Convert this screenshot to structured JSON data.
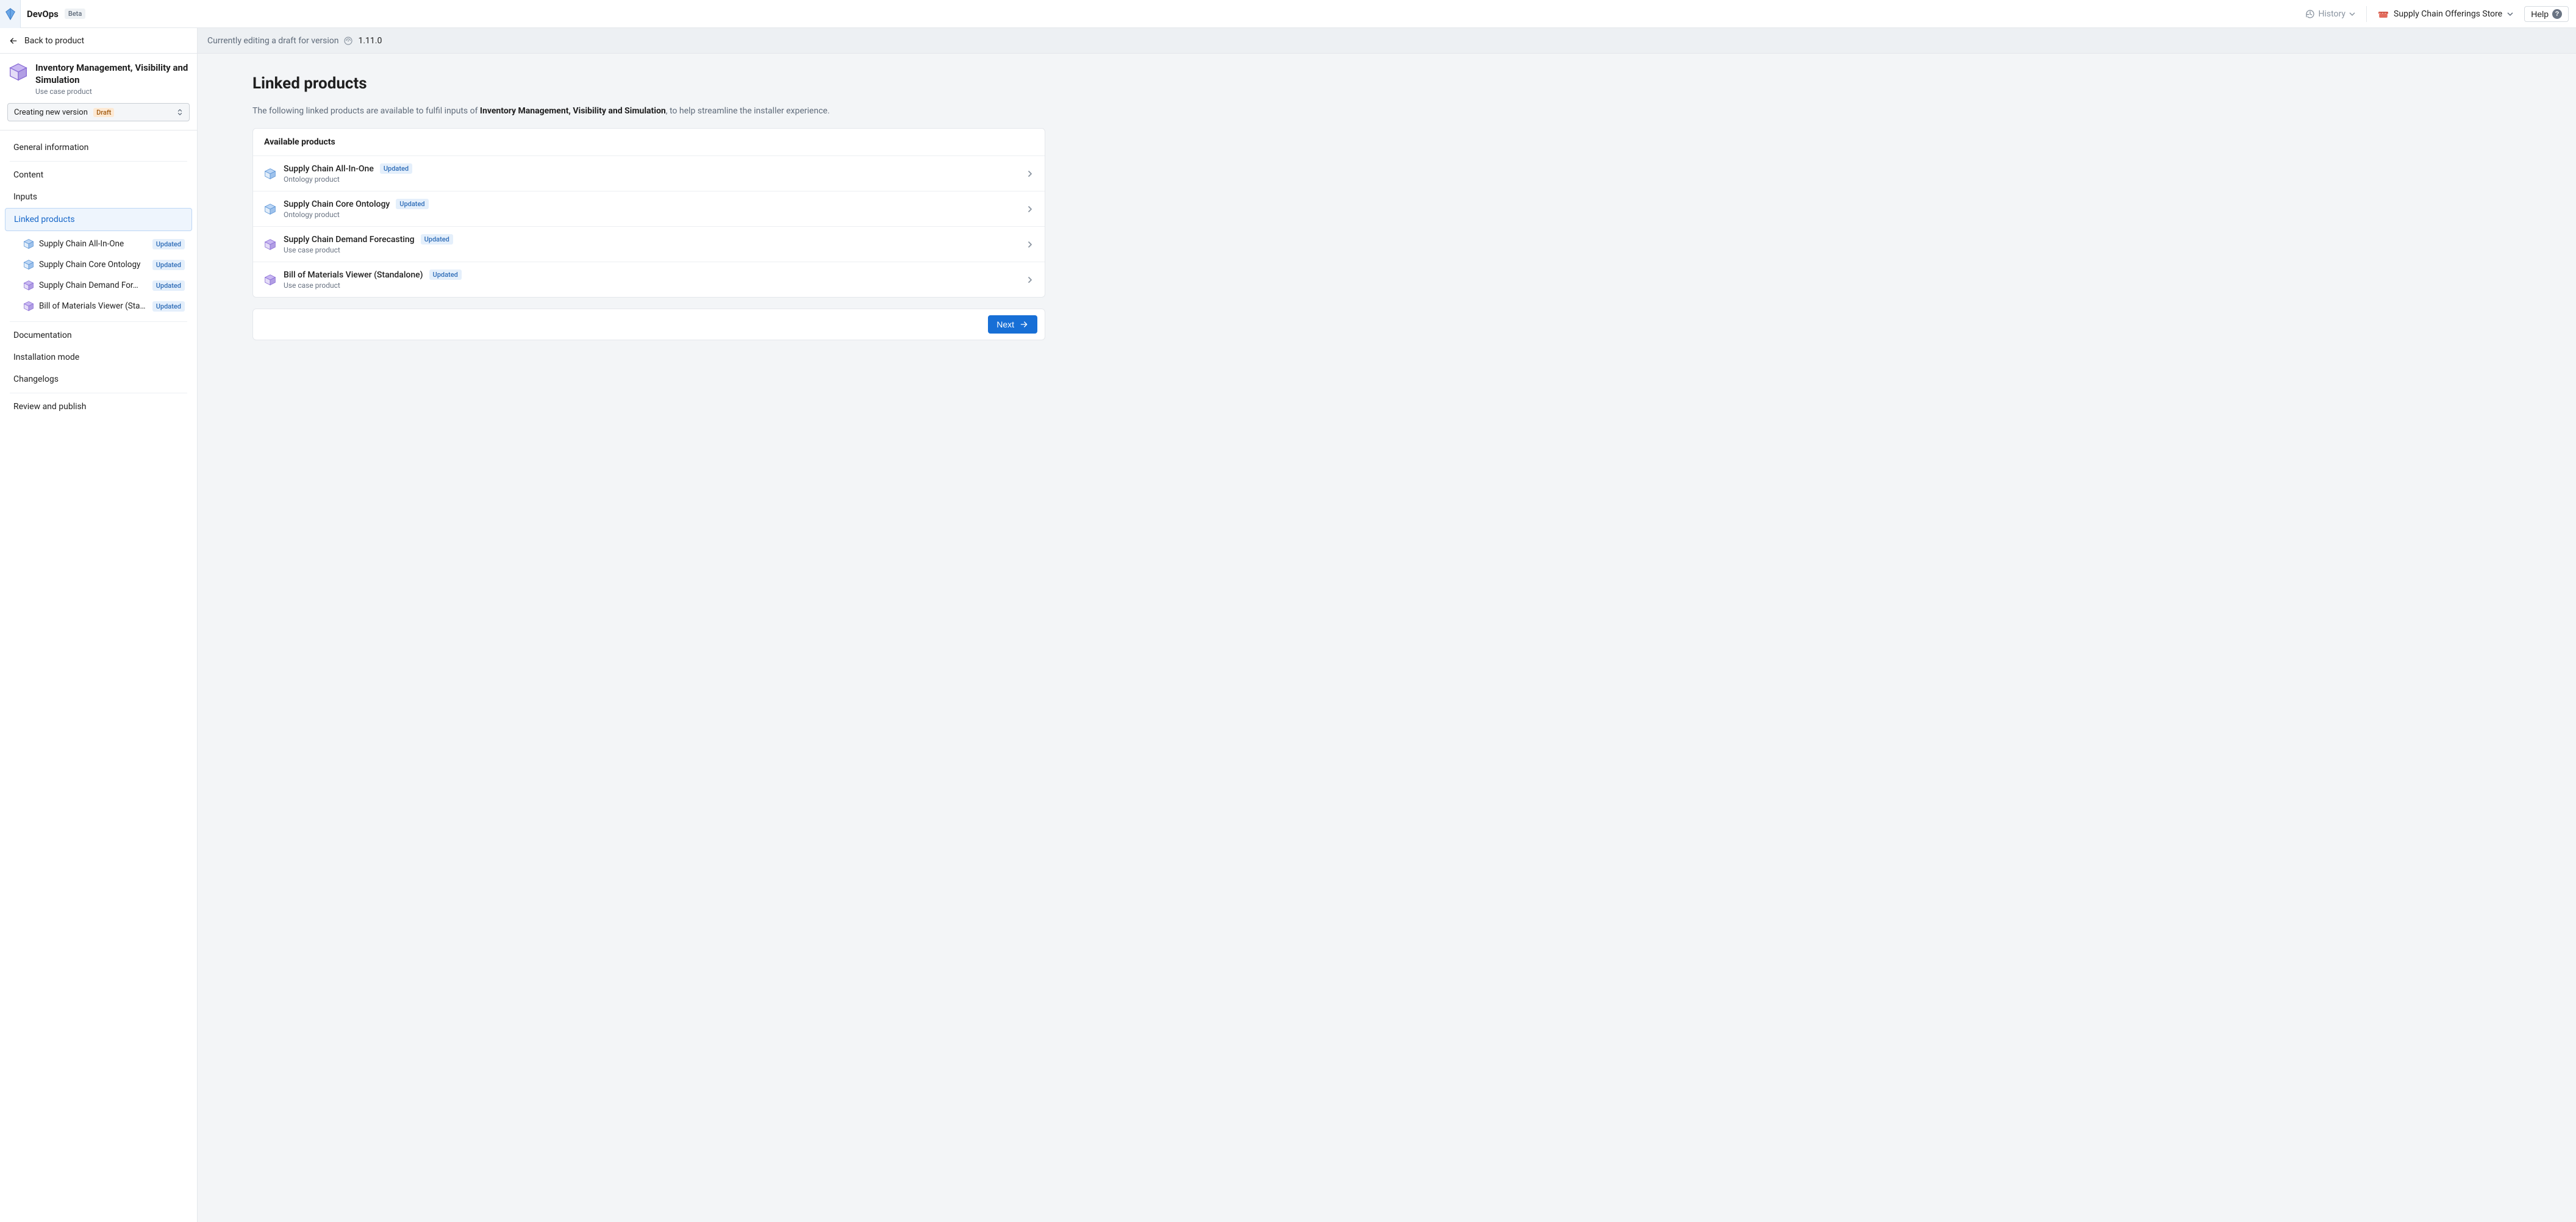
{
  "topbar": {
    "app_name": "DevOps",
    "beta_label": "Beta",
    "history_label": "History",
    "store_name": "Supply Chain Offerings Store",
    "help_label": "Help"
  },
  "sidebar": {
    "back_label": "Back to product",
    "product_title": "Inventory Management, Visibility and Simulation",
    "product_subtitle": "Use case product",
    "version_select_label": "Creating new version",
    "version_select_badge": "Draft",
    "nav": {
      "general": "General information",
      "content": "Content",
      "inputs": "Inputs",
      "linked_products": "Linked products",
      "documentation": "Documentation",
      "installation_mode": "Installation mode",
      "changelogs": "Changelogs",
      "review_publish": "Review and publish"
    },
    "linked_subitems": [
      {
        "label": "Supply Chain All-In-One",
        "badge": "Updated",
        "icon_variant": "blue"
      },
      {
        "label": "Supply Chain Core Ontology",
        "badge": "Updated",
        "icon_variant": "blue"
      },
      {
        "label": "Supply Chain Demand For…",
        "badge": "Updated",
        "icon_variant": "purple"
      },
      {
        "label": "Bill of Materials Viewer (Sta…",
        "badge": "Updated",
        "icon_variant": "purple"
      }
    ]
  },
  "banner": {
    "prefix": "Currently editing a draft for version",
    "version": "1.11.0"
  },
  "main": {
    "title": "Linked products",
    "desc_prefix": "The following linked products are available to fulfil inputs of ",
    "desc_strong": "Inventory Management, Visibility and Simulation",
    "desc_suffix": ", to help streamline the installer experience.",
    "panel_header": "Available products",
    "products": [
      {
        "name": "Supply Chain All-In-One",
        "badge": "Updated",
        "subtitle": "Ontology product",
        "icon_variant": "blue"
      },
      {
        "name": "Supply Chain Core Ontology",
        "badge": "Updated",
        "subtitle": "Ontology product",
        "icon_variant": "blue"
      },
      {
        "name": "Supply Chain Demand Forecasting",
        "badge": "Updated",
        "subtitle": "Use case product",
        "icon_variant": "purple"
      },
      {
        "name": "Bill of Materials Viewer (Standalone)",
        "badge": "Updated",
        "subtitle": "Use case product",
        "icon_variant": "purple"
      }
    ],
    "next_label": "Next"
  },
  "colors": {
    "primary": "#176fd6",
    "draft_bg": "#fde9d3",
    "draft_fg": "#a15b12",
    "updated_bg": "#e4effb",
    "updated_fg": "#2f6db8"
  }
}
